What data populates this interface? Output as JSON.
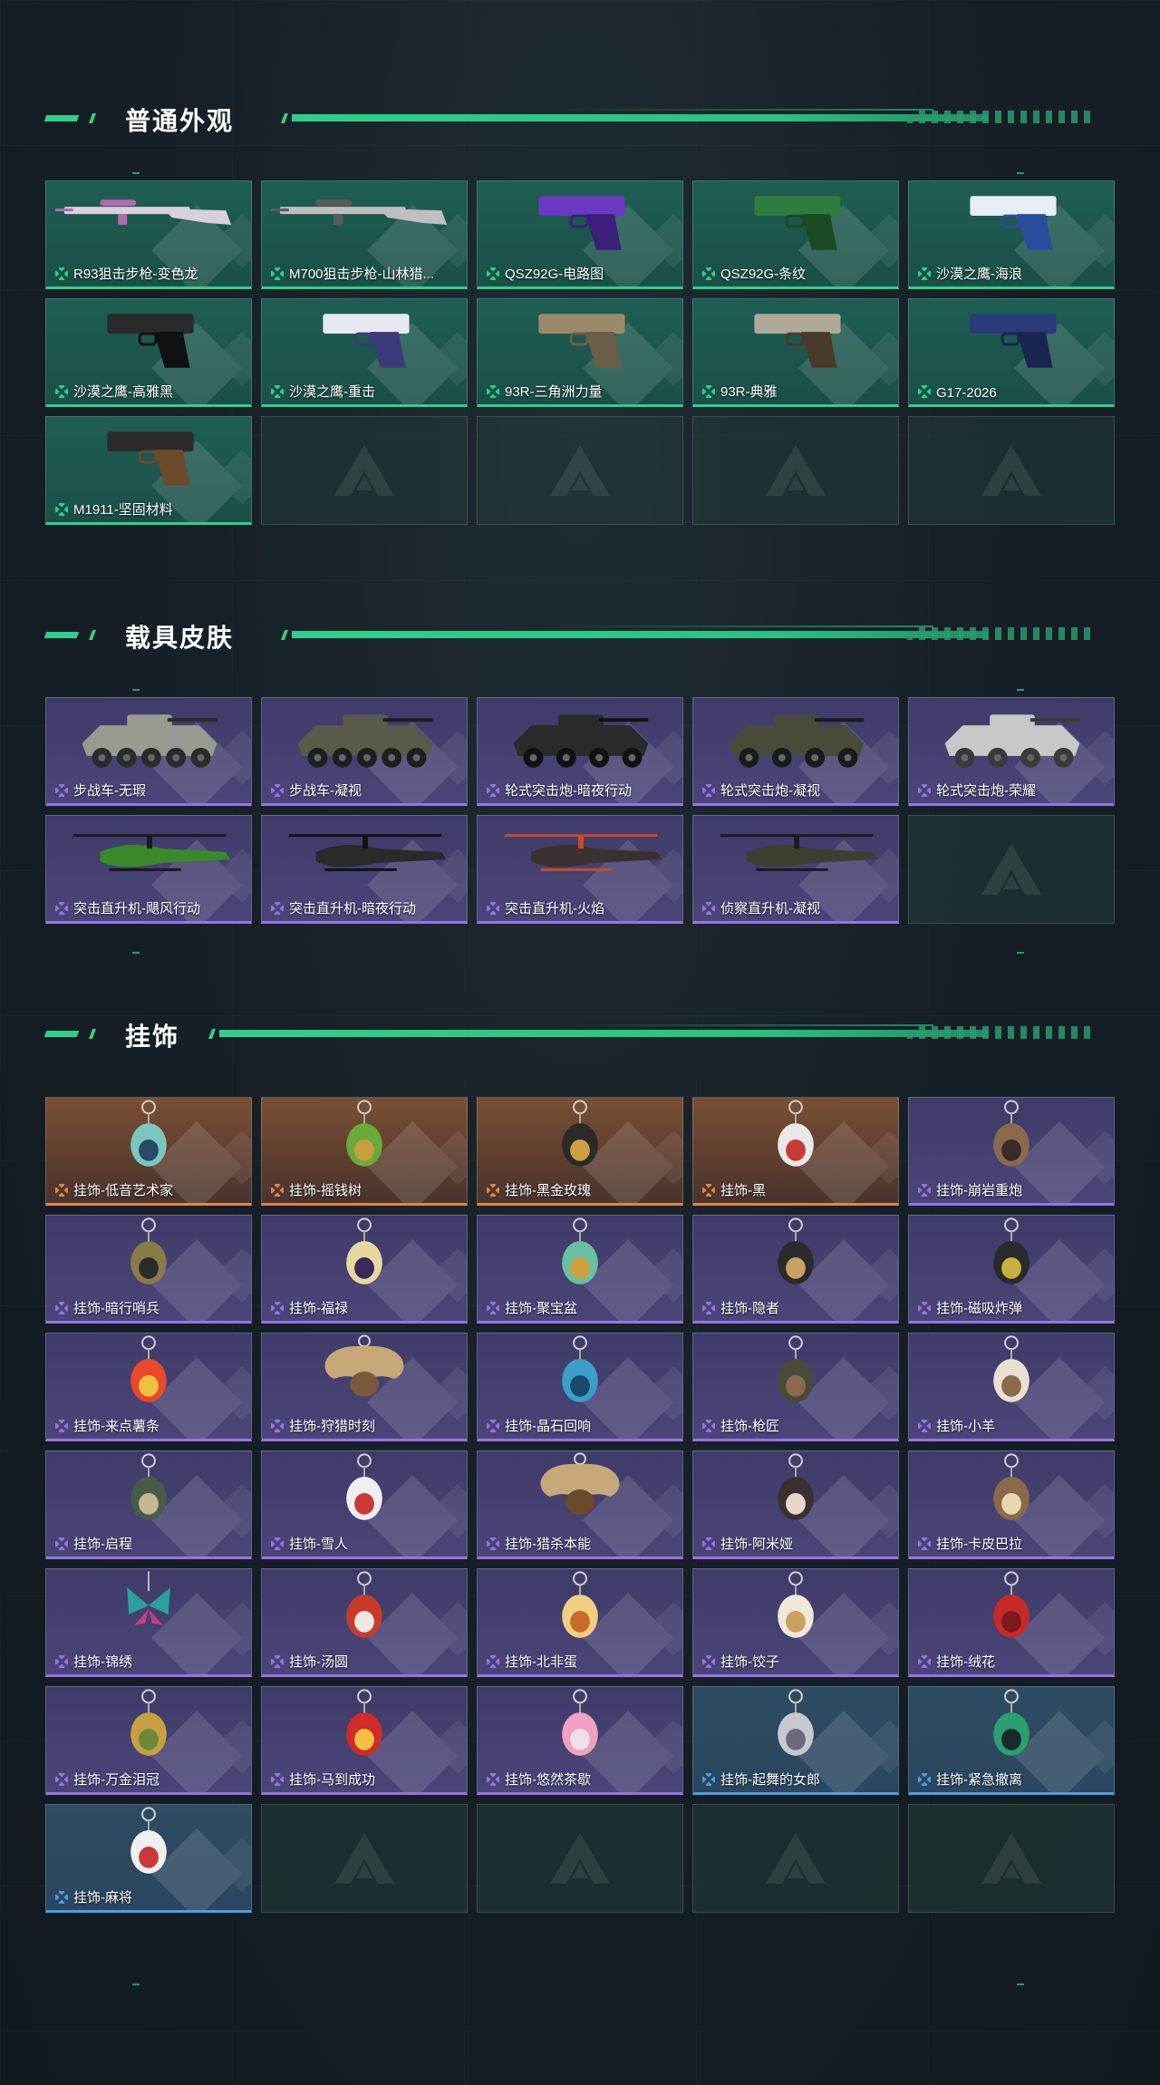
{
  "sections": {
    "weapons": {
      "title": "普通外观",
      "items": [
        {
          "label": "R93狙击步枪-变色龙",
          "art": "sniper-rifle-icon",
          "colors": [
            "#d9d0dc",
            "#b26ab0"
          ]
        },
        {
          "label": "M700狙击步枪-山林猎...",
          "art": "sniper-rifle-icon",
          "colors": [
            "#bfbfbf",
            "#5a5a5a"
          ]
        },
        {
          "label": "QSZ92G-电路图",
          "art": "pistol-icon",
          "colors": [
            "#6a3ac4",
            "#3b1f7a"
          ]
        },
        {
          "label": "QSZ92G-条纹",
          "art": "pistol-icon",
          "colors": [
            "#2e7d3e",
            "#1a4a24"
          ]
        },
        {
          "label": "沙漠之鹰-海浪",
          "art": "pistol-icon",
          "colors": [
            "#e6eef7",
            "#2a4d9e"
          ]
        },
        {
          "label": "沙漠之鹰-高雅黑",
          "art": "pistol-icon",
          "colors": [
            "#2a2a2a",
            "#111111"
          ]
        },
        {
          "label": "沙漠之鹰-重击",
          "art": "pistol-icon",
          "colors": [
            "#e8e8f0",
            "#3b3b7a"
          ]
        },
        {
          "label": "93R-三角洲力量",
          "art": "pistol-icon",
          "colors": [
            "#9a8a6a",
            "#6b5e46"
          ]
        },
        {
          "label": "93R-典雅",
          "art": "pistol-icon",
          "colors": [
            "#b0a898",
            "#4a3a2a"
          ]
        },
        {
          "label": "G17-2026",
          "art": "pistol-icon",
          "colors": [
            "#2a3a7a",
            "#1a2450"
          ]
        },
        {
          "label": "M1911-坚固材料",
          "art": "pistol-icon",
          "colors": [
            "#2a2a2a",
            "#6a4a2a"
          ]
        }
      ],
      "empty_slots": 4
    },
    "vehicles": {
      "title": "载具皮肤",
      "items": [
        {
          "label": "步战车-无瑕",
          "art": "ifv-icon",
          "colors": [
            "#9a9a90",
            "#2a2a2a"
          ]
        },
        {
          "label": "步战车-凝视",
          "art": "ifv-icon",
          "colors": [
            "#5a5a4a",
            "#1e1e1e"
          ]
        },
        {
          "label": "轮式突击炮-暗夜行动",
          "art": "armored-car-icon",
          "colors": [
            "#2a2a2a",
            "#111111"
          ]
        },
        {
          "label": "轮式突击炮-凝视",
          "art": "armored-car-icon",
          "colors": [
            "#4a4a3a",
            "#1a1a1a"
          ]
        },
        {
          "label": "轮式突击炮-荣耀",
          "art": "armored-car-icon",
          "colors": [
            "#c8c8c8",
            "#3a3a3a"
          ]
        },
        {
          "label": "突击直升机-飓风行动",
          "art": "helicopter-icon",
          "colors": [
            "#3a8a2a",
            "#1a1a1a"
          ]
        },
        {
          "label": "突击直升机-暗夜行动",
          "art": "helicopter-icon",
          "colors": [
            "#2a2a2a",
            "#111111"
          ]
        },
        {
          "label": "突击直升机-火焰",
          "art": "helicopter-icon",
          "colors": [
            "#3a3030",
            "#c84a2a"
          ]
        },
        {
          "label": "侦察直升机-凝视",
          "art": "scout-helicopter-icon",
          "colors": [
            "#3a4030",
            "#1a1a1a"
          ]
        }
      ],
      "empty_slots": 1
    },
    "charms": {
      "title": "挂饰",
      "items": [
        {
          "label": "挂饰-低音艺术家",
          "rarity": "orange",
          "art": "charm-icon",
          "colors": [
            "#7ac6c0",
            "#2a4a6a"
          ]
        },
        {
          "label": "挂饰-摇钱树",
          "rarity": "orange",
          "art": "charm-icon",
          "colors": [
            "#6aaa3a",
            "#c8a040"
          ]
        },
        {
          "label": "挂饰-黑金玫瑰",
          "rarity": "orange",
          "art": "charm-icon",
          "colors": [
            "#2a2a2a",
            "#d0a040"
          ]
        },
        {
          "label": "挂饰-黑",
          "rarity": "orange",
          "art": "charm-icon",
          "colors": [
            "#e8e8e8",
            "#c83a3a"
          ]
        },
        {
          "label": "挂饰-崩岩重炮",
          "rarity": "purple",
          "art": "charm-icon",
          "colors": [
            "#8a6a4a",
            "#3a2a2a"
          ]
        },
        {
          "label": "挂饰-暗行哨兵",
          "rarity": "purple",
          "art": "charm-icon",
          "colors": [
            "#8a7a4a",
            "#2a2a2a"
          ]
        },
        {
          "label": "挂饰-福禄",
          "rarity": "purple",
          "art": "charm-icon",
          "colors": [
            "#e8d8a0",
            "#3a2a5a"
          ]
        },
        {
          "label": "挂饰-聚宝盆",
          "rarity": "purple",
          "art": "charm-icon",
          "colors": [
            "#6ac0a0",
            "#d0a040"
          ]
        },
        {
          "label": "挂饰-隐者",
          "rarity": "purple",
          "art": "charm-icon",
          "colors": [
            "#2a2a2a",
            "#c8a060"
          ]
        },
        {
          "label": "挂饰-磁吸炸弹",
          "rarity": "purple",
          "art": "charm-icon",
          "colors": [
            "#2a2a2a",
            "#c8b040"
          ]
        },
        {
          "label": "挂饰-来点薯条",
          "rarity": "purple",
          "art": "charm-icon",
          "colors": [
            "#e84a2a",
            "#f0c040"
          ]
        },
        {
          "label": "挂饰-狩猎时刻",
          "rarity": "purple",
          "art": "antler-icon",
          "colors": [
            "#c8a878",
            "#7a5a3a"
          ]
        },
        {
          "label": "挂饰-晶石回响",
          "rarity": "purple",
          "art": "charm-icon",
          "colors": [
            "#3aa0c8",
            "#1a4a6a"
          ]
        },
        {
          "label": "挂饰-枪匠",
          "rarity": "purple",
          "art": "charm-icon",
          "colors": [
            "#4a4a3a",
            "#8a6a4a"
          ]
        },
        {
          "label": "挂饰-小羊",
          "rarity": "purple",
          "art": "charm-icon",
          "colors": [
            "#e8e0d0",
            "#8a6a4a"
          ]
        },
        {
          "label": "挂饰-启程",
          "rarity": "purple",
          "art": "charm-icon",
          "colors": [
            "#4a5a4a",
            "#c8b890"
          ]
        },
        {
          "label": "挂饰-雪人",
          "rarity": "purple",
          "art": "charm-icon",
          "colors": [
            "#f0f0f0",
            "#c83a3a"
          ]
        },
        {
          "label": "挂饰-猎杀本能",
          "rarity": "purple",
          "art": "antler-icon",
          "colors": [
            "#c8a878",
            "#6a4a2a"
          ]
        },
        {
          "label": "挂饰-阿米娅",
          "rarity": "purple",
          "art": "charm-icon",
          "colors": [
            "#3a3030",
            "#e8d8c8"
          ]
        },
        {
          "label": "挂饰-卡皮巴拉",
          "rarity": "purple",
          "art": "charm-icon",
          "colors": [
            "#8a6a4a",
            "#e8d8b0"
          ]
        },
        {
          "label": "挂饰-锦绣",
          "rarity": "purple",
          "art": "butterfly-icon",
          "colors": [
            "#2aa0a0",
            "#c83a8a"
          ]
        },
        {
          "label": "挂饰-汤圆",
          "rarity": "purple",
          "art": "charm-icon",
          "colors": [
            "#c83a2a",
            "#f0e8e0"
          ]
        },
        {
          "label": "挂饰-北非蛋",
          "rarity": "purple",
          "art": "charm-icon",
          "colors": [
            "#f0d080",
            "#c86a2a"
          ]
        },
        {
          "label": "挂饰-饺子",
          "rarity": "purple",
          "art": "charm-icon",
          "colors": [
            "#f0e8d8",
            "#c8a060"
          ]
        },
        {
          "label": "挂饰-绒花",
          "rarity": "purple",
          "art": "charm-icon",
          "colors": [
            "#c82a2a",
            "#7a1a1a"
          ]
        },
        {
          "label": "挂饰-万金泪冠",
          "rarity": "purple",
          "art": "charm-icon",
          "colors": [
            "#c8a040",
            "#6a8a3a"
          ]
        },
        {
          "label": "挂饰-马到成功",
          "rarity": "purple",
          "art": "charm-icon",
          "colors": [
            "#d02a2a",
            "#f0c040"
          ]
        },
        {
          "label": "挂饰-悠然茶歇",
          "rarity": "purple",
          "art": "charm-icon",
          "colors": [
            "#f0a0c0",
            "#f0e0e8"
          ]
        },
        {
          "label": "挂饰-起舞的女郎",
          "rarity": "blue",
          "art": "charm-icon",
          "colors": [
            "#c8c8d0",
            "#6a6a7a"
          ]
        },
        {
          "label": "挂饰-紧急撤离",
          "rarity": "blue",
          "art": "charm-icon",
          "colors": [
            "#2aa070",
            "#1a2a2a"
          ]
        },
        {
          "label": "挂饰-麻将",
          "rarity": "blue",
          "art": "charm-icon",
          "colors": [
            "#f0f0f0",
            "#c83a3a"
          ]
        }
      ],
      "empty_slots": 4
    }
  },
  "colors": {
    "accent_green": "#2fd18a",
    "rarity_green": "#2fd18a",
    "rarity_purple": "#9a72e6",
    "rarity_orange": "#e08744",
    "rarity_blue": "#4aa0e8"
  }
}
